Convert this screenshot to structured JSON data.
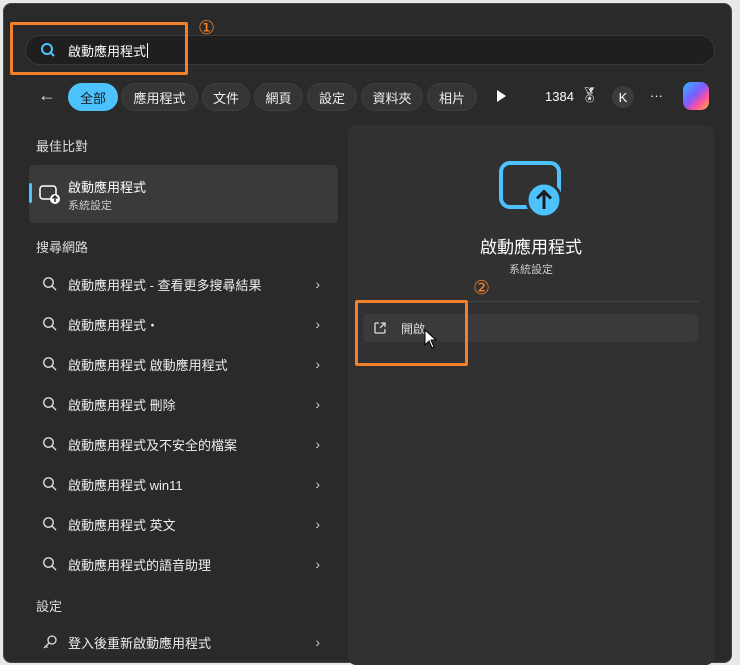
{
  "search": {
    "value": "啟動應用程式",
    "annotation": "①"
  },
  "filters": {
    "back": "←",
    "tabs": [
      "全部",
      "應用程式",
      "文件",
      "網頁",
      "設定",
      "資料夾",
      "相片"
    ],
    "points": "1384",
    "avatar": "K",
    "more": "···"
  },
  "best_match": {
    "heading": "最佳比對",
    "title": "啟動應用程式",
    "subtitle": "系統設定"
  },
  "web": {
    "heading": "搜尋網路",
    "items": [
      "啟動應用程式 - 查看更多搜尋結果",
      "啟動應用程式・",
      "啟動應用程式 啟動應用程式",
      "啟動應用程式 刪除",
      "啟動應用程式及不安全的檔案",
      "啟動應用程式 win11",
      "啟動應用程式 英文",
      "啟動應用程式的語音助理"
    ]
  },
  "settings": {
    "heading": "設定",
    "items": [
      "登入後重新啟動應用程式"
    ]
  },
  "preview": {
    "title": "啟動應用程式",
    "subtitle": "系統設定",
    "open_label": "開啟",
    "annotation": "②"
  },
  "colors": {
    "accent": "#4cc2ff",
    "annotation": "#f0812a"
  }
}
